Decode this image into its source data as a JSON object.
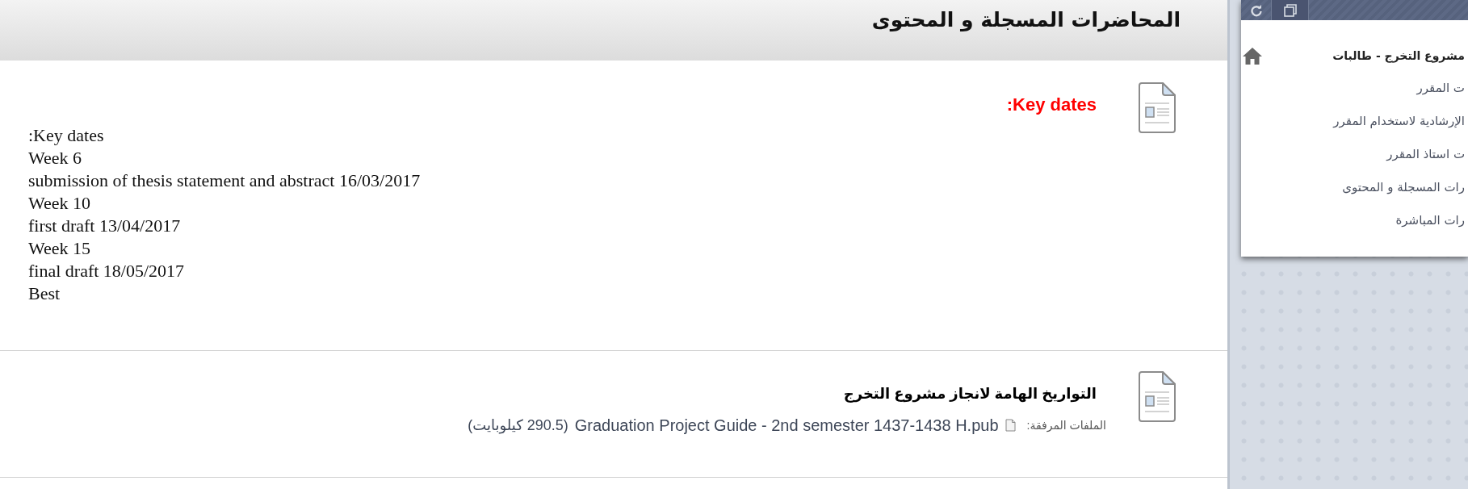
{
  "page": {
    "title": "المحاضرات المسجلة و المحتوى"
  },
  "items": [
    {
      "kind": "text",
      "title": ":Key dates",
      "color": "#ff0000",
      "body": [
        ":Key dates",
        "Week 6",
        "submission of thesis statement and abstract 16/03/2017",
        "Week 10",
        "first draft 13/04/2017",
        "Week 15",
        "final draft 18/05/2017",
        "Best"
      ]
    },
    {
      "kind": "file",
      "title": "التواريخ الهامة لانجاز مشروع التخرج",
      "color": "#000000",
      "attachments": {
        "label": "الملفات المرفقة:",
        "file": "Graduation Project Guide - 2nd semester 1437-1438 H.pub",
        "size": "(290.5 كيلوبايت)"
      }
    }
  ],
  "course_menu": {
    "title": "مشروع التخرج - طالبات",
    "items": [
      "ت المقرر",
      "الإرشادية لاستخدام المقرر",
      "ت استاذ المقرر",
      "رات المسجلة و المحتوى",
      "رات المباشرة"
    ]
  }
}
